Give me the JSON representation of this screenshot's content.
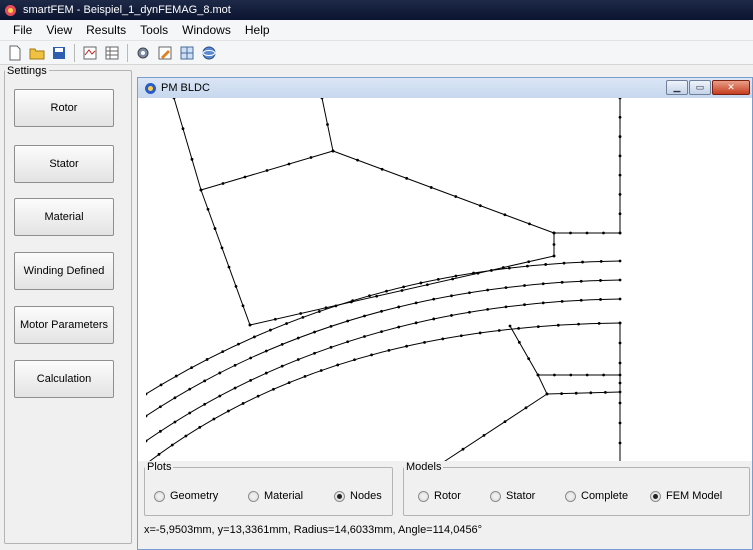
{
  "app": {
    "title": "smartFEM  -  Beispiel_1_dynFEMAG_8.mot"
  },
  "menu": [
    "File",
    "View",
    "Results",
    "Tools",
    "Windows",
    "Help"
  ],
  "toolbar": {
    "icons": [
      "new-file-icon",
      "open-folder-icon",
      "save-icon",
      "motor-icon",
      "table-icon",
      "gear-icon",
      "edit-icon",
      "grid-icon",
      "sphere-icon"
    ]
  },
  "settings": {
    "legend": "Settings",
    "buttons": [
      "Rotor",
      "Stator",
      "Material",
      "Winding Defined",
      "Motor Parameters",
      "Calculation"
    ]
  },
  "child_window": {
    "title": "PM BLDC"
  },
  "plots": {
    "legend": "Plots",
    "options": [
      "Geometry",
      "Material",
      "Nodes"
    ],
    "selected": "Nodes"
  },
  "models": {
    "legend": "Models",
    "options": [
      "Rotor",
      "Stator",
      "Complete",
      "FEM Model"
    ],
    "selected": "FEM Model"
  },
  "status": "x=-5,9503mm,   y=13,3361mm,   Radius=14,6033mm,   Angle=114,0456°",
  "colors": {
    "titlebar": "#0b1430",
    "mdi_title": "#c7d7ee",
    "close_button": "#c53c20"
  }
}
